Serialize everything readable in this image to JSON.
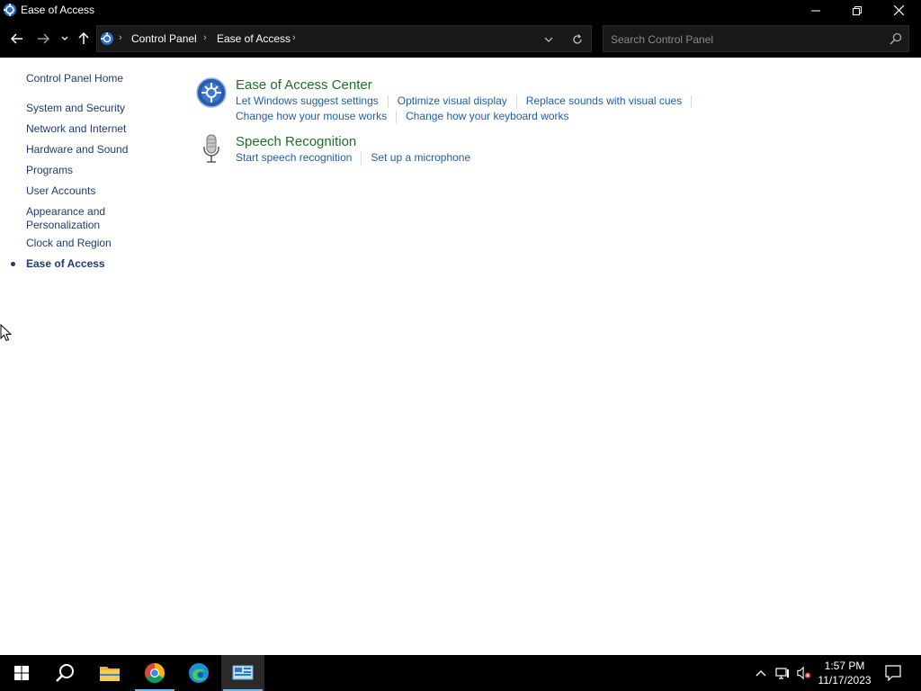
{
  "window": {
    "title": "Ease of Access"
  },
  "address": {
    "crumbs": [
      "Control Panel",
      "Ease of Access"
    ]
  },
  "search": {
    "placeholder": "Search Control Panel"
  },
  "leftpane": {
    "home": "Control Panel Home",
    "items": [
      "System and Security",
      "Network and Internet",
      "Hardware and Sound",
      "Programs",
      "User Accounts",
      "Appearance and",
      "Personalization",
      "Clock and Region",
      "Ease of Access"
    ],
    "current": "Ease of Access"
  },
  "main": {
    "categories": [
      {
        "title": "Ease of Access Center",
        "icon": "ease-of-access-icon",
        "links": [
          "Let Windows suggest settings",
          "Optimize visual display",
          "Replace sounds with visual cues",
          "Change how your mouse works",
          "Change how your keyboard works"
        ]
      },
      {
        "title": "Speech Recognition",
        "icon": "microphone-icon",
        "links": [
          "Start speech recognition",
          "Set up a microphone"
        ]
      }
    ]
  },
  "taskbar": {
    "time": "1:57 PM",
    "date": "11/17/2023",
    "apps": [
      "start",
      "search",
      "file-explorer",
      "chrome",
      "edge",
      "control-panel"
    ]
  },
  "colors": {
    "accent_link": "#1f5fa8",
    "category_title": "#1e6e2e",
    "nav_text": "#1e3b6e",
    "chrome_bg": "#000000"
  }
}
